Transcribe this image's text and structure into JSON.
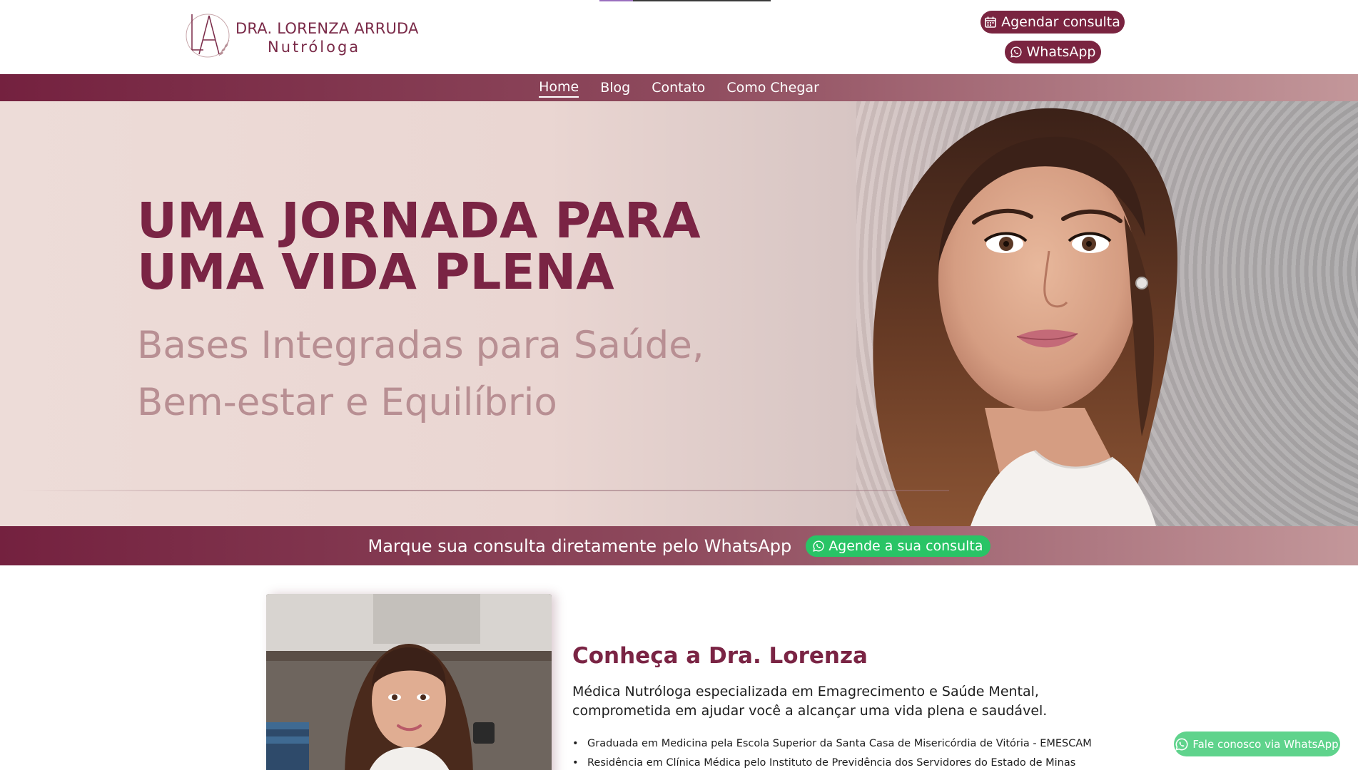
{
  "header": {
    "logo": {
      "monogram": "LA",
      "name": "DRA. LORENZA ARRUDA",
      "subtitle": "Nutróloga"
    },
    "buttons": {
      "agendar_label": "Agendar consulta",
      "agendar_icon": "calendar-icon",
      "whatsapp_label": "WhatsApp",
      "whatsapp_icon": "whatsapp-icon"
    }
  },
  "nav": {
    "items": [
      {
        "label": "Home",
        "active": true
      },
      {
        "label": "Blog",
        "active": false
      },
      {
        "label": "Contato",
        "active": false
      },
      {
        "label": "Como Chegar",
        "active": false
      }
    ]
  },
  "hero": {
    "title_line1": "UMA JORNADA PARA",
    "title_line2": "UMA VIDA PLENA",
    "subtitle_line1": "Bases Integradas para Saúde,",
    "subtitle_line2": "Bem-estar e Equilíbrio"
  },
  "band": {
    "text": "Marque sua consulta diretamente pelo WhatsApp",
    "button_label": "Agende a sua consulta"
  },
  "about": {
    "title": "Conheça a Dra. Lorenza",
    "text_line1": "Médica Nutróloga especializada em Emagrecimento e Saúde Mental,",
    "text_line2": "comprometida em ajudar você a alcançar uma vida plena e saudável.",
    "list": [
      "Graduada em Medicina pela Escola Superior da Santa Casa de Misericórdia de Vitória - EMESCAM",
      "Residência em Clínica Médica pelo Instituto de Previdência dos Servidores do Estado de Minas"
    ]
  },
  "floating_whatsapp": {
    "label": "Fale conosco via WhatsApp"
  },
  "colors": {
    "brand": "#7a2444",
    "brand_light": "#b88f93",
    "whatsapp_green": "#29c466"
  }
}
